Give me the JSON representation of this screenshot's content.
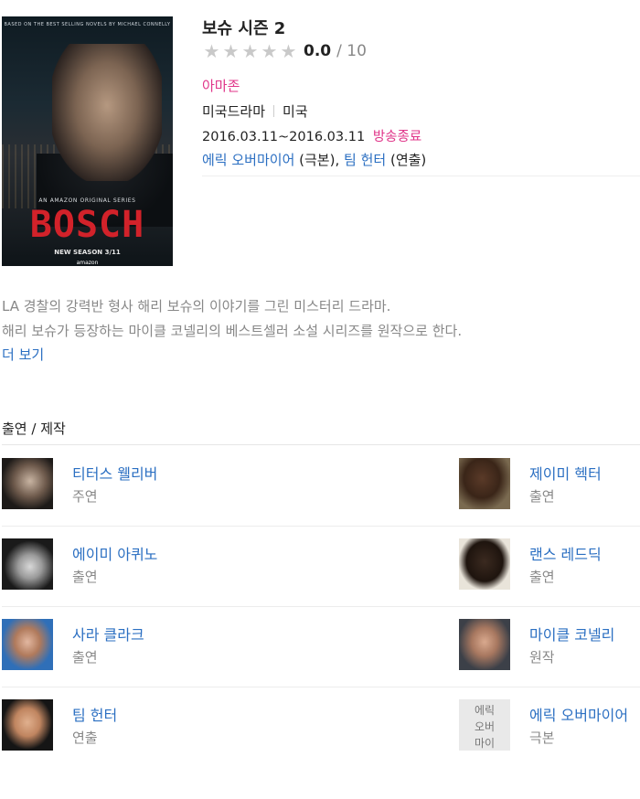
{
  "poster": {
    "tagline": "BASED ON THE BEST SELLING NOVELS BY MICHAEL CONNELLY",
    "series_line": "AN AMAZON ORIGINAL SERIES",
    "title": "BOSCH",
    "season_line": "NEW SEASON 3/11",
    "brand": "amazon"
  },
  "show": {
    "title": "보슈 시즌 2",
    "rating": {
      "stars": [
        "★",
        "★",
        "★",
        "★",
        "★"
      ],
      "score": "0.0",
      "max": "/ 10"
    },
    "channel": "아마존",
    "genre": "미국드라마",
    "country": "미국",
    "dates": "2016.03.11~2016.03.11",
    "status": "방송종료",
    "credits": {
      "writer_name": "에릭 오버마이어",
      "writer_role": "(극본),",
      "director_name": "팀 헌터",
      "director_role": "(연출)"
    }
  },
  "description": {
    "line1": "LA 경찰의 강력반 형사 해리 보슈의 이야기를 그린 미스터리 드라마.",
    "line2": "해리 보슈가 등장하는 마이클 코넬리의 베스트셀러 소설 시리즈를 원작으로 한다.",
    "more_label": "더 보기"
  },
  "cast_section": {
    "title": "출연 / 제작",
    "rows": [
      {
        "left": {
          "name": "티터스 웰리버",
          "role": "주연"
        },
        "right": {
          "name": "제이미 헥터",
          "role": "출연"
        }
      },
      {
        "left": {
          "name": "에이미 아퀴노",
          "role": "출연"
        },
        "right": {
          "name": "랜스 레드딕",
          "role": "출연"
        }
      },
      {
        "left": {
          "name": "사라 클라크",
          "role": "출연"
        },
        "right": {
          "name": "마이클 코넬리",
          "role": "원작"
        }
      },
      {
        "left": {
          "name": "팀 헌터",
          "role": "연출"
        },
        "right": {
          "name": "에릭 오버마이어",
          "role": "극본",
          "placeholder_text": "에릭 오버 마이"
        }
      }
    ]
  }
}
